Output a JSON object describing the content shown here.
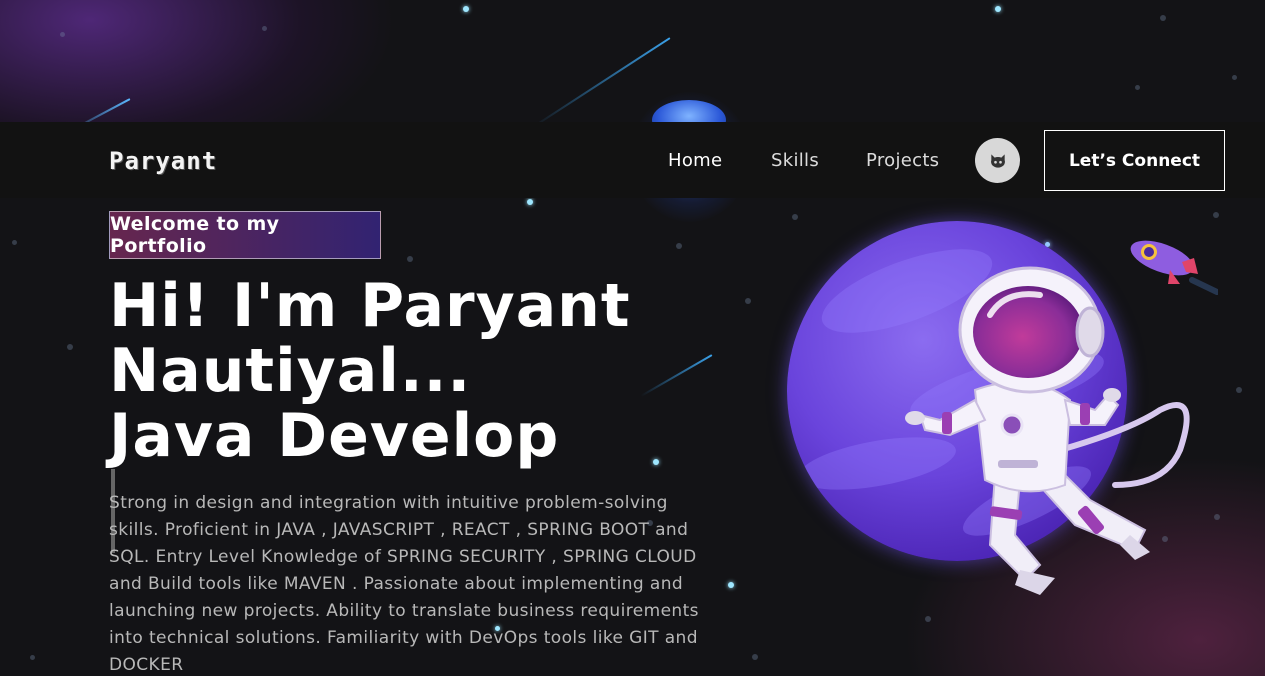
{
  "navbar": {
    "logo": "Paryant",
    "links": [
      {
        "label": "Home",
        "active": true
      },
      {
        "label": "Skills",
        "active": false
      },
      {
        "label": "Projects",
        "active": false
      }
    ],
    "social_icon": "github-icon",
    "connect_label": "Let’s Connect"
  },
  "hero": {
    "tagline": "Welcome to my Portfolio",
    "title_line1": "Hi! I'm Paryant",
    "title_line2": "Nautiyal...",
    "title_line3": "Java Develop",
    "description": "Strong in design and integration with intuitive problem-solving skills. Proficient in JAVA , JAVASCRIPT , REACT , SPRING BOOT and SQL. Entry Level Knowledge of SPRING SECURITY , SPRING CLOUD and Build tools like MAVEN . Passionate about implementing and launching new projects. Ability to translate business requirements into technical solutions. Familiarity with DevOps tools like GIT and DOCKER"
  },
  "illustration": {
    "subject": "astronaut-floating-near-planet",
    "accent": "#6a44dc",
    "rocket": "rocket-icon"
  },
  "colors": {
    "background": "#121212",
    "tagline_gradient_start": "#aa367c",
    "tagline_gradient_end": "#4a2fbd",
    "star": "#9fe7ff"
  }
}
